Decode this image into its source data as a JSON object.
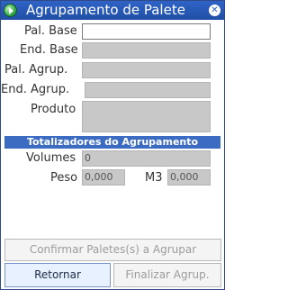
{
  "window": {
    "title": "Agrupamento de Palete",
    "close_symbol": "✕"
  },
  "form": {
    "pal_base_label": "Pal. Base",
    "pal_base_value": "",
    "end_base_label": "End. Base",
    "end_base_value": "",
    "pal_agrup_label": "Pal. Agrup.",
    "pal_agrup_value": "",
    "end_agrup_label": "End. Agrup.",
    "end_agrup_value": "",
    "produto_label": "Produto",
    "produto_value": ""
  },
  "totals": {
    "header": "Totalizadores do Agrupamento",
    "volumes_label": "Volumes",
    "volumes_value": "0",
    "peso_label": "Peso",
    "peso_value": "0,000",
    "m3_label": "M3",
    "m3_value": "0,000"
  },
  "buttons": {
    "confirm_label": "Confirmar Paletes(s) a Agrupar",
    "return_label": "Retornar",
    "finalize_label": "Finalizar Agrup."
  }
}
